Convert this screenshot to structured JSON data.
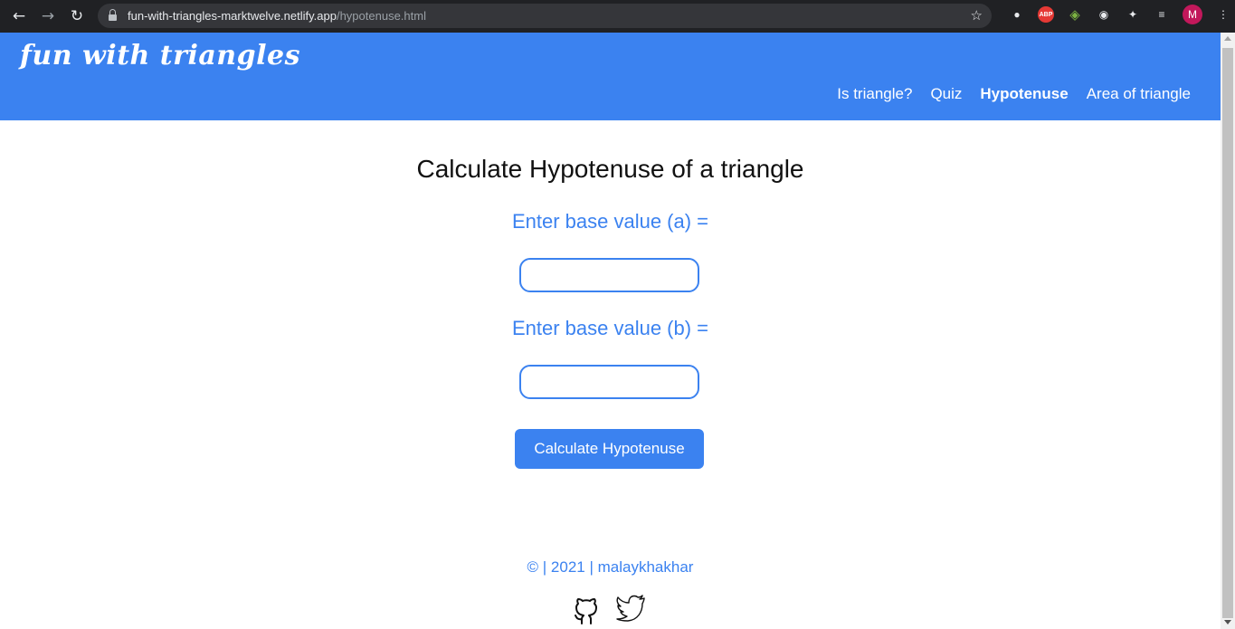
{
  "browser": {
    "url_host": "fun-with-triangles-marktwelve.netlify.app",
    "url_path": "/hypotenuse.html",
    "profile_initial": "M",
    "abp_label": "ABP"
  },
  "site": {
    "title": "fun with triangles",
    "nav": [
      {
        "label": "Is triangle?"
      },
      {
        "label": "Quiz"
      },
      {
        "label": "Hypotenuse"
      },
      {
        "label": "Area of triangle"
      }
    ],
    "active_nav": "Hypotenuse"
  },
  "main": {
    "heading": "Calculate Hypotenuse of a triangle",
    "field_a_label": "Enter base value (a) =",
    "field_a_value": "",
    "field_b_label": "Enter base value (b) =",
    "field_b_value": "",
    "button_label": "Calculate Hypotenuse"
  },
  "footer": {
    "text": "© | 2021 | malaykhakhar",
    "icons": [
      "github-icon",
      "twitter-icon"
    ]
  },
  "colors": {
    "accent": "#3b82f0",
    "chrome_bg": "#202124"
  }
}
